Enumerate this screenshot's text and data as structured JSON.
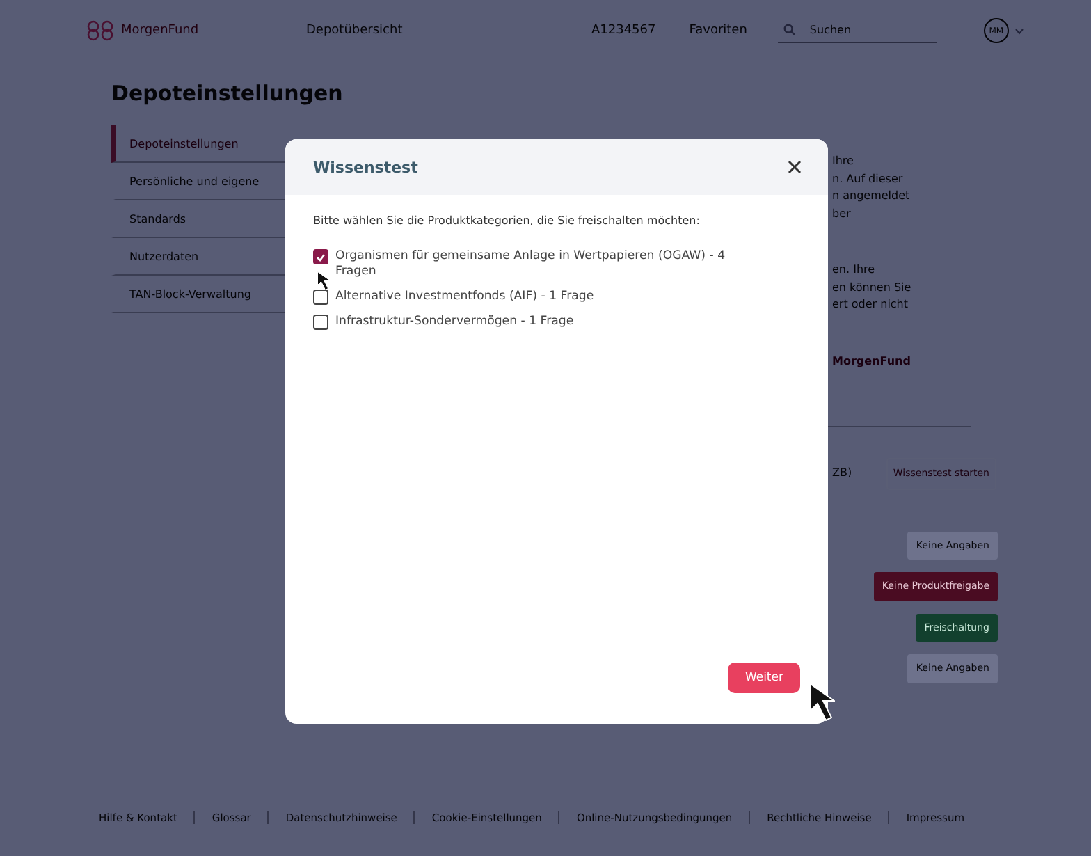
{
  "header": {
    "logo": "MorgenFund",
    "nav_link": "Depotübersicht",
    "account_number": "A1234567",
    "favorites": "Favoriten",
    "search": {
      "placeholder": "Suchen"
    },
    "avatar": "MM"
  },
  "page_title": "Depoteinstellungen",
  "sidebar": {
    "items": [
      {
        "label": "Depoteinstellungen",
        "selected": true
      },
      {
        "label": "Persönliche und eigene",
        "selected": false
      },
      {
        "label": "Standards",
        "selected": false
      },
      {
        "label": "Nutzerdaten",
        "selected": false
      },
      {
        "label": "TAN-Block-Verwaltung",
        "selected": false
      }
    ]
  },
  "background_text": {
    "paragraph_1": [
      "Ihre",
      "n. Auf dieser",
      "n angemeldet",
      "ber"
    ],
    "paragraph_2": [
      "en. Ihre",
      "en können Sie",
      "ert oder nicht"
    ],
    "brand": "MorgenFund",
    "row_label": "ZB)",
    "row_button": "Wissenstest starten",
    "status_buttons": [
      {
        "label": "Keine Angaben",
        "kind": "neutral"
      },
      {
        "label": "Keine Produktfreigabe",
        "kind": "blocked"
      },
      {
        "label": "Freischaltung",
        "kind": "approved"
      },
      {
        "label": "Keine Angaben",
        "kind": "neutral"
      }
    ]
  },
  "modal": {
    "title": "Wissenstest",
    "intro": "Bitte wählen Sie die Produktkategorien, die Sie freischalten möchten:",
    "options": [
      {
        "label": "Organismen für gemeinsame Anlage in Wertpapieren (OGAW) - 4 Fragen",
        "checked": true
      },
      {
        "label": "Alternative Investmentfonds (AIF) - 1 Frage",
        "checked": false
      },
      {
        "label": "Infrastruktur-Sondervermögen - 1 Frage",
        "checked": false
      }
    ],
    "button": "Weiter"
  },
  "footer": {
    "links": [
      "Hilfe & Kontakt",
      "Glossar",
      "Datenschutzhinweise",
      "Cookie-Einstellungen",
      "Online-Nutzungsbedingungen",
      "Rechtliche Hinweise",
      "Impressum"
    ]
  }
}
